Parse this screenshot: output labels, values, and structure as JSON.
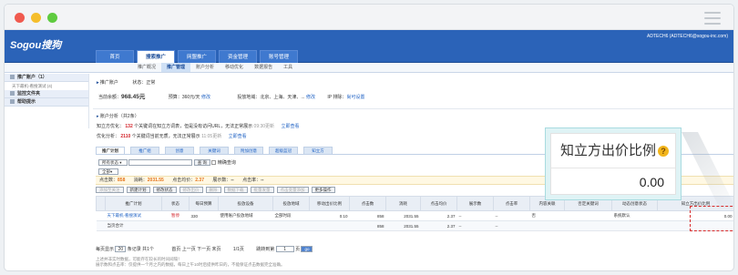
{
  "browser": {
    "window_dots": [
      "#f05a4f",
      "#f5be2c",
      "#5fcb40"
    ]
  },
  "header": {
    "logo": "Sogou搜狗",
    "user": "ADTECH6 (ADTECH6@sogou-inc.com)",
    "main_tabs": [
      {
        "label": "首页",
        "active": false
      },
      {
        "label": "搜索推广",
        "active": true
      },
      {
        "label": "网盟推广",
        "active": false
      },
      {
        "label": "资金管理",
        "active": false
      },
      {
        "label": "账号管理",
        "active": false
      }
    ],
    "sub_tabs": [
      {
        "label": "推广概况",
        "active": false
      },
      {
        "label": "推广管理",
        "active": true
      },
      {
        "label": "账户分析",
        "active": false
      },
      {
        "label": "移动优化",
        "active": false
      },
      {
        "label": "数据报告",
        "active": false
      },
      {
        "label": "工具",
        "active": false
      }
    ]
  },
  "sidebar": {
    "sections": [
      {
        "title": "推广账户（1）",
        "items": [
          "天下最机-看搜演试 (4)"
        ]
      },
      {
        "title": "监控文件夹",
        "items": []
      },
      {
        "title": "帮助提示",
        "items": []
      }
    ]
  },
  "account": {
    "title_label": "推广账户",
    "name": "推广账户",
    "status_label": "状态：",
    "status": "正常",
    "balance_label": "当前余额：",
    "balance": "968.45元",
    "budget_label": "预算",
    "budget": "360元/天",
    "budget_edit": "修改",
    "region_label": "投放地域",
    "region": "北京、上海、天津、...",
    "region_edit": "修改",
    "ip_label": "IP 排除",
    "ip_action": "尚可设置"
  },
  "analysis": {
    "title": "账户分析（共2条）",
    "items": [
      {
        "label": "知立方优化：",
        "count": "132",
        "text": "个关键词在知立方词表，但是没有访问URL，无法正常展示",
        "time": "09:30更新",
        "action": "立即查看"
      },
      {
        "label": "优化分析：",
        "count": "2110",
        "text": "个关键词当前无质，无法正常展示",
        "time": "11:05更新",
        "action": "立即查看"
      }
    ]
  },
  "content_tabs": [
    {
      "label": "推广计划",
      "active": true
    },
    {
      "label": "推广组",
      "active": false
    },
    {
      "label": "创意",
      "active": false
    },
    {
      "label": "关键词",
      "active": false
    },
    {
      "label": "附加创意",
      "active": false
    },
    {
      "label": "超级蓝冠",
      "active": false
    },
    {
      "label": "知立方",
      "active": false
    }
  ],
  "filter": {
    "status_select": "所有状态",
    "search_button": "查 询",
    "exact_label": "精确查询",
    "range_select": "全部"
  },
  "stats": {
    "impr_label": "点击数：",
    "impr": "858",
    "cost_label": "消耗：",
    "cost": "2031.55",
    "cpc_label": "点击均价：",
    "cpc": "2.37",
    "show_label": "展示数：",
    "show": "--",
    "ctr_label": "点击率：",
    "ctr": "--"
  },
  "toolbar": [
    "添加至关注",
    "新建计划",
    "修改状态",
    "修改出价",
    "删除",
    "数据下载",
    "批量发量",
    "点击变量添加",
    "更多操作"
  ],
  "table": {
    "headers": [
      "推广计划",
      "状态",
      "每日预算",
      "投放设备",
      "投放地域",
      "移动出价比例",
      "点击数",
      "消耗",
      "点击均价",
      "展示数",
      "点击率",
      "内容关联",
      "否定关键词",
      "动态创意状态",
      "知立方出价比例"
    ],
    "rows": [
      [
        "天下最机-看搜演试",
        "暂停",
        "330",
        "使用账户投放地域",
        "全部时段",
        "0.10",
        "858",
        "2031.55",
        "2.37",
        "--",
        "--",
        "否",
        "",
        "系统默认",
        "0.00"
      ]
    ],
    "total": [
      "当页合计",
      "",
      "",
      "",
      "",
      "",
      "858",
      "2031.55",
      "2.37",
      "--",
      "--",
      "",
      "",
      "",
      ""
    ]
  },
  "pager": {
    "per_page_label": "每页显示",
    "per_page": "20",
    "suffix": "条记录 共1个",
    "nav": "首页 上一页 下一页 末页",
    "page": "1/1页",
    "jump_label": "跳转到第",
    "jump_value": "1",
    "jump_suffix": "页",
    "go": "go"
  },
  "notes": [
    "上述并非实时数据，可能存在较长的时间间隔！",
    "展示数和点击率：仅提供一个月之内的数据，每日上午10时后提供昨日的，不能保证点击数据完全准确。"
  ],
  "tooltip": {
    "title": "知立方出价比例",
    "value": "0.00",
    "help": "?"
  }
}
